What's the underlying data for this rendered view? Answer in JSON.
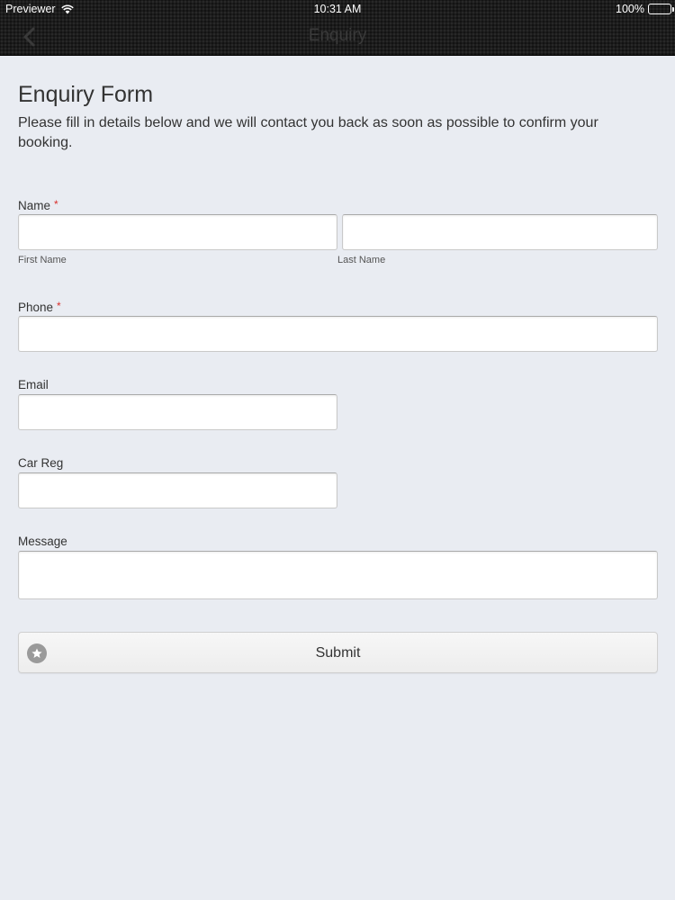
{
  "status_bar": {
    "carrier": "Previewer",
    "time": "10:31 AM",
    "battery": "100%"
  },
  "nav": {
    "title": "Enquiry",
    "back_icon": "chevron-left-icon"
  },
  "form": {
    "title": "Enquiry Form",
    "description": "Please fill in details below and we will contact you back as soon as possible to confirm your booking.",
    "required_marker": "*",
    "fields": {
      "name": {
        "label": "Name",
        "required": true,
        "first_name_sublabel": "First Name",
        "last_name_sublabel": "Last Name",
        "first_name_value": "",
        "last_name_value": ""
      },
      "phone": {
        "label": "Phone",
        "required": true,
        "value": ""
      },
      "email": {
        "label": "Email",
        "required": false,
        "value": ""
      },
      "car_reg": {
        "label": "Car Reg",
        "required": false,
        "value": ""
      },
      "message": {
        "label": "Message",
        "required": false,
        "value": ""
      }
    },
    "submit": {
      "label": "Submit",
      "icon": "star-icon"
    }
  },
  "colors": {
    "background": "#e9ecf2",
    "top_bar": "#1c1c1c",
    "required": "#d9302c"
  }
}
